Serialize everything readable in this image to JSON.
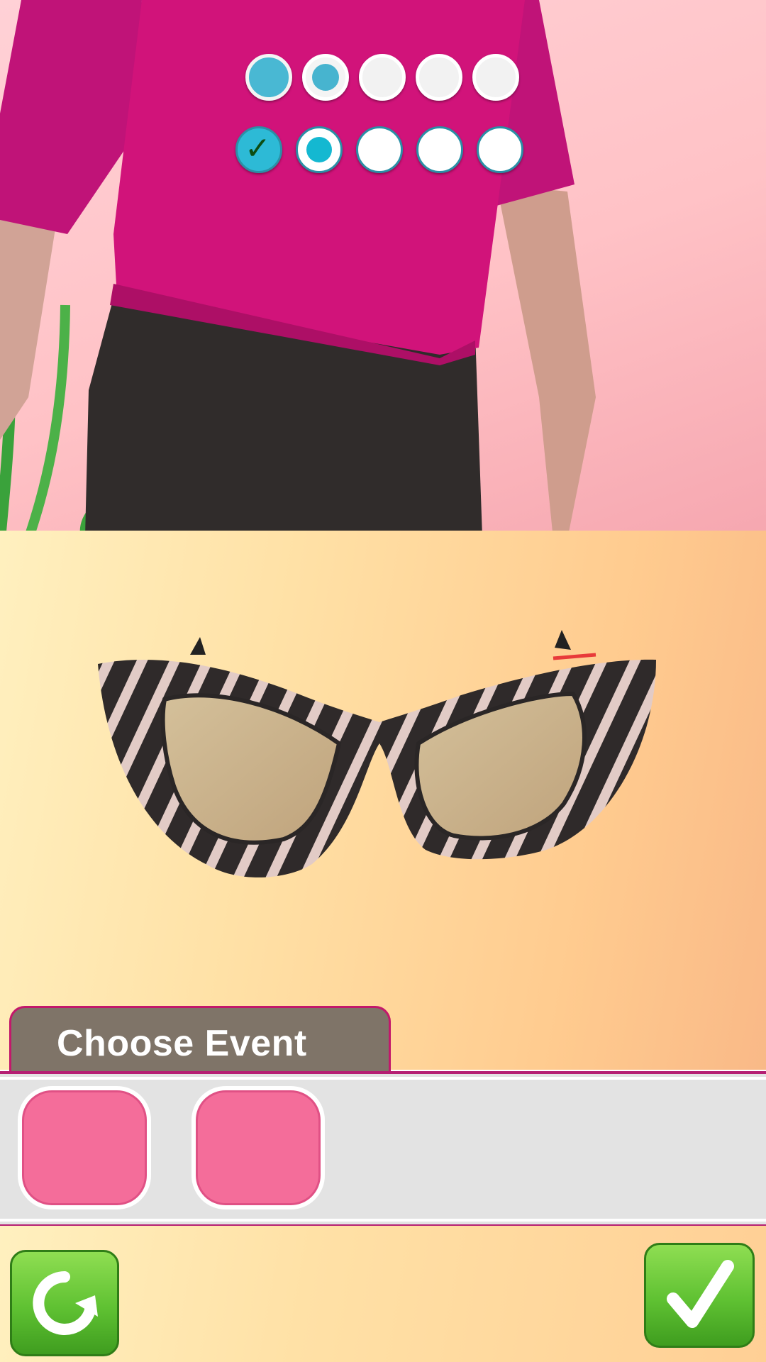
{
  "progress": {
    "row1": [
      "filled",
      "filled-inner",
      "empty",
      "empty",
      "empty"
    ],
    "row2": [
      "done",
      "current",
      "empty",
      "empty",
      "empty"
    ]
  },
  "featured_item": "cat-eye-sunglasses-striped",
  "event_panel": {
    "title": "Choose Event",
    "slot_count": 2
  },
  "buttons": {
    "restart_icon": "restart-icon",
    "confirm_icon": "checkmark-icon"
  },
  "colors": {
    "accent_pink": "#c2186b",
    "slot_pink": "#f46d9a",
    "confirm_green": "#5fc132",
    "progress_blue": "#49b8d3"
  }
}
